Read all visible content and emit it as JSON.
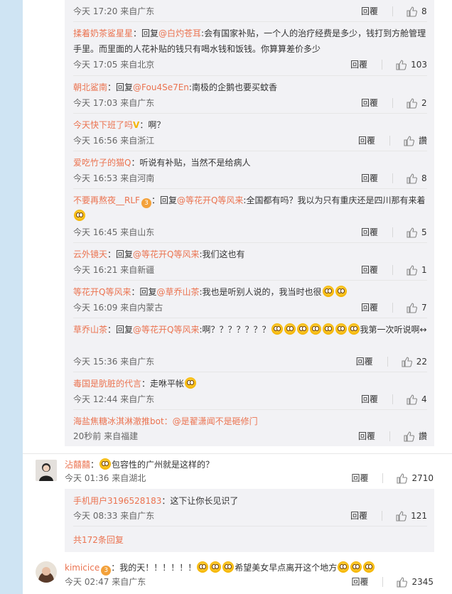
{
  "colors": {
    "link": "#eb7350",
    "bg": "#cfe4f3",
    "subbox": "#f2f2f5"
  },
  "replies": [
    {
      "time": "今天 17:20 来自广东",
      "likes": "8",
      "reply": "回覆"
    },
    {
      "user": "揉着奶茶鲨星星",
      "prefix": "：回复",
      "mention": "@白灼苍耳",
      "text": ":会有国家补贴，一个人的治疗经费是多少，钱打到方舱管理手里。而里面的人花补贴的钱只有喝水钱和饭钱。你算算差价多少",
      "time": "今天 17:05 来自北京",
      "reply": "回覆",
      "likes": "103"
    },
    {
      "user": "朝北鲨南",
      "prefix": "：回复",
      "mention": "@Fou4Se7En",
      "text": ":南极的企鹅也要买蚊香",
      "time": "今天 17:03 来自广东",
      "reply": "回覆",
      "likes": "2"
    },
    {
      "user": "今天快下班了吗",
      "text": "：啊？",
      "time": "今天 16:56 来自浙江",
      "reply": "回覆",
      "likes": "讚"
    },
    {
      "user": "爱吃竹子的猫Q",
      "text": "：听说有补贴，当然不是给病人",
      "time": "今天 16:53 来自河南",
      "reply": "回覆",
      "likes": "8"
    },
    {
      "user": "不要再熬夜__RLF",
      "prefix": "：回复",
      "mention": "@等花开Q等风来",
      "text": ":全国都有吗？我以为只有重庆还是四川那有来着",
      "time": "今天 16:45 来自山东",
      "reply": "回覆",
      "likes": "5"
    },
    {
      "user": "云外镜天",
      "prefix": "：回复",
      "mention": "@等花开Q等风来",
      "text": ":我们这也有",
      "time": "今天 16:21 来自新疆",
      "reply": "回覆",
      "likes": "1"
    },
    {
      "user": "等花开Q等风来",
      "prefix": "：回复",
      "mention": "@草乔山茶",
      "text": ":我也是听别人说的，我当时也很",
      "time": "今天 16:09 来自内蒙古",
      "reply": "回覆",
      "likes": "7"
    },
    {
      "user": "草乔山茶",
      "prefix": "：回复",
      "mention": "@等花开Q等风来",
      "text": ":啊？？？？？？？",
      "text2": "我第一次听说啊↔",
      "time": "今天 15:36 来自广东",
      "reply": "回覆",
      "likes": "22"
    },
    {
      "user": "毒国是肮脏的代言",
      "text": "：走咻平帐",
      "time": "今天 12:44 来自广东",
      "reply": "回覆",
      "likes": "4"
    },
    {
      "user": "海盐焦糖冰淇淋澈推bot",
      "text": "：@是翟潇闻不是砸修门",
      "time": "20秒前 来自福建",
      "reply": "回覆",
      "likes": "讚"
    }
  ],
  "comment2": {
    "user": "沾囍囍",
    "text": "包容性的广州就是这样的？",
    "time": "今天 01:36 来自湖北",
    "reply": "回覆",
    "likes": "2710",
    "sub": {
      "user": "手机用户3196528183",
      "text": "：这下让你长见识了",
      "time": "今天 08:33 来自广东",
      "reply": "回覆",
      "likes": "121"
    },
    "more": "共172条回复"
  },
  "comment3": {
    "user": "kimicice",
    "text": "：我的天！！！！！！",
    "text2": "希望美女早点离开这个地方",
    "time": "今天 02:47 来自广东",
    "reply": "回覆",
    "likes": "2345"
  }
}
